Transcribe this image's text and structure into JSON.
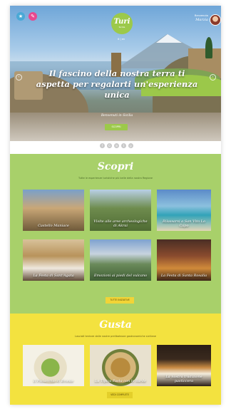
{
  "header": {
    "logo_name": "Turi",
    "logo_tagline": "Sicilia",
    "lang": "it | en",
    "user_welcome": "Benvenuto",
    "user_name": "Marzia",
    "top_icons": [
      "pin-icon",
      "chat-icon",
      "share-icon",
      "edit-icon"
    ]
  },
  "hero": {
    "headline": "Il fascino della nostra terra ti aspetta per regalarti un'esperienza unica",
    "welcome": "Benvenuti in Sicilia",
    "button": "SCOPRI"
  },
  "share_icons": [
    "f",
    "G",
    "in",
    "t",
    "p"
  ],
  "scopri": {
    "title": "Scopri",
    "subtitle": "Tutte le esperienze turistiche più belle della nostra Regione",
    "cards": [
      {
        "caption": "Castello Maniace"
      },
      {
        "caption": "Visite alle aree archeologiche di Akrai"
      },
      {
        "caption": "Rilassarsi a San Vito Lo Capo"
      },
      {
        "caption": "La Festa di Sant'Agata"
      },
      {
        "caption": "Emozioni ai piedi del vulcano"
      },
      {
        "caption": "La Festa di Santa Rosalia"
      }
    ],
    "button": "TUTTE INIZIATIVE"
  },
  "gusta": {
    "title": "Gusta",
    "subtitle": "Lasciati tentare dalle nostre prelibatezze gastronomiche siciliane",
    "cards": [
      {
        "caption": "Il Pistacchio di Bronte"
      },
      {
        "caption": "La Tipica Pasta con le Sarde"
      },
      {
        "caption": "La nostra tradizione pasticcera"
      }
    ],
    "button": "VEDI COMPLETE"
  },
  "colors": {
    "green": "#9cc94a",
    "scopri_bg": "#a8d06a",
    "gusta_bg": "#f3e23f",
    "blue_icon": "#4aa9d6",
    "pink_icon": "#e8488e"
  }
}
